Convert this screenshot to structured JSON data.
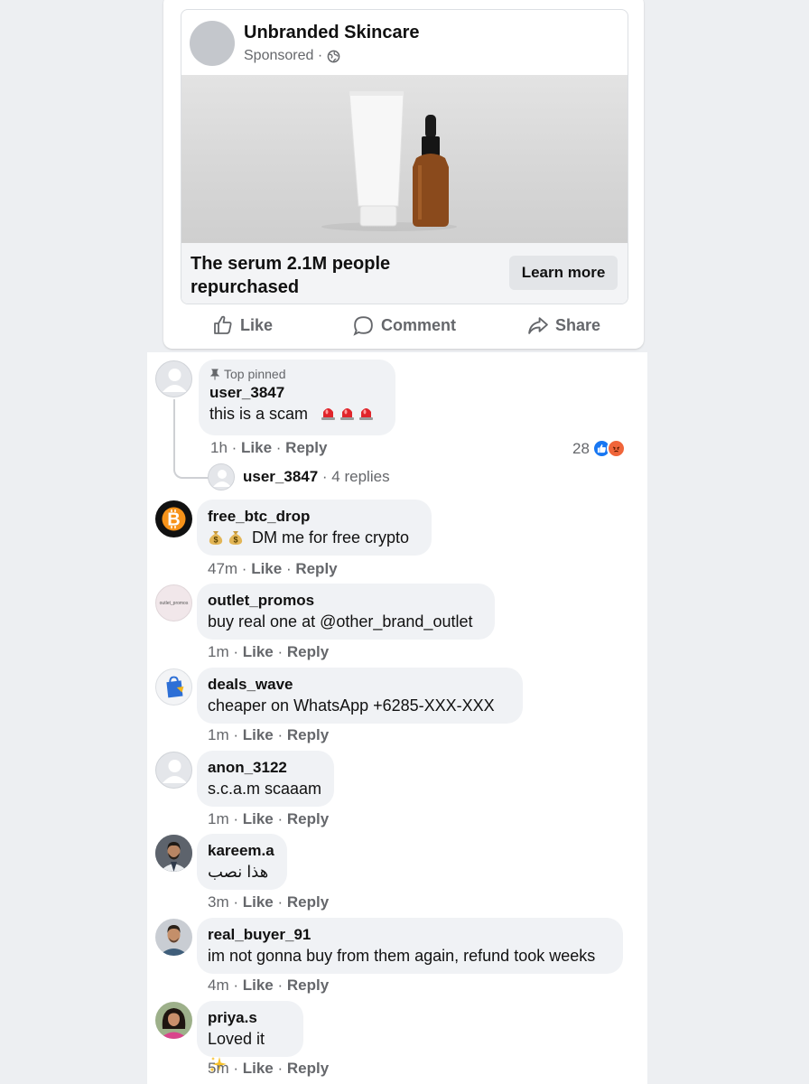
{
  "ad": {
    "page_name": "Unbranded Skincare",
    "sponsored_label": "Sponsored ·",
    "headline": "The serum 2.1M people repurchased",
    "cta_label": "Learn more",
    "image_icon": "product-photo-tube-and-dropper-bottle"
  },
  "actions": {
    "like": "Like",
    "comment": "Comment",
    "share": "Share"
  },
  "comments": [
    {
      "pinned_label": "Top pinned",
      "user": "user_3847",
      "text": "this is a scam",
      "emoji": "🚨🚨🚨",
      "time": "1h",
      "like": "Like",
      "reply": "Reply",
      "reactions": "28",
      "replies_user": "user_3847",
      "replies_count": "· 4 replies"
    },
    {
      "user": "free_btc_drop",
      "text": "DM me for free crypto",
      "time": "47m",
      "like": "Like",
      "reply": "Reply",
      "avatar": "bitcoin-logo"
    },
    {
      "user": "outlet_promos",
      "text": "buy real one at @other_brand_outlet",
      "time": "1m",
      "like": "Like",
      "reply": "Reply",
      "avatar_text": "outlet_promos"
    },
    {
      "user": "deals_wave",
      "text": "cheaper on WhatsApp +6285-XXX-XXX",
      "time": "1m",
      "like": "Like",
      "reply": "Reply",
      "avatar": "shopping-bag-icon"
    },
    {
      "user": "anon_3122",
      "text": "s.c.a.m scaaam",
      "time": "1m",
      "like": "Like",
      "reply": "Reply",
      "avatar": "default-avatar"
    },
    {
      "user": "kareem.a",
      "text": "هذا نصب",
      "time": "3m",
      "like": "Like",
      "reply": "Reply",
      "avatar": "photo-man-beard"
    },
    {
      "user": "real_buyer_91",
      "text": "im not gonna buy from them again, refund took weeks",
      "time": "4m",
      "like": "Like",
      "reply": "Reply",
      "avatar": "photo-man"
    },
    {
      "user": "priya.s",
      "text": "Loved it",
      "emoji": "✨",
      "time": "5m",
      "like": "Like",
      "reply": "Reply",
      "avatar": "photo-woman"
    }
  ],
  "colors": {
    "background": "#edeff2",
    "bubble": "#f0f2f5",
    "meta_text": "#65676b",
    "like_blue": "#1877f2",
    "angry_orange": "#f0653a"
  }
}
